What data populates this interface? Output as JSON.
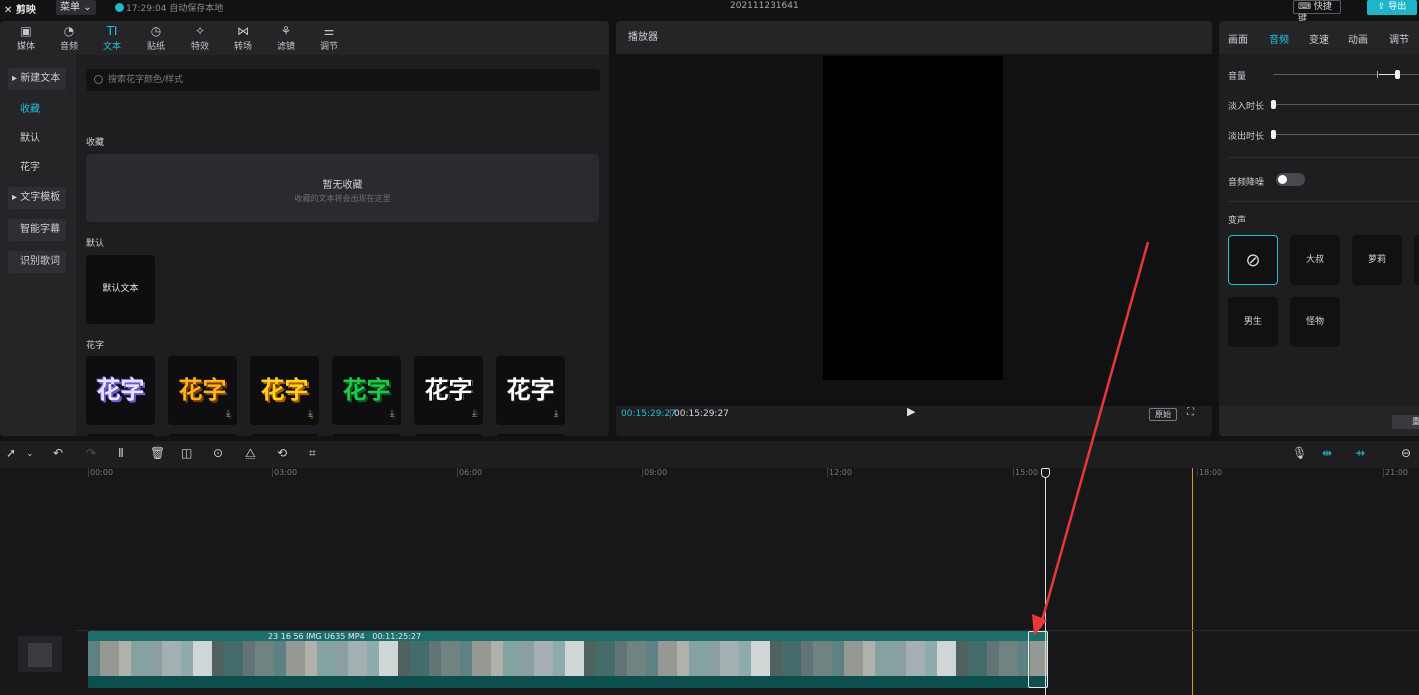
{
  "titlebar": {
    "app_name": "剪映",
    "menu_label": "菜单",
    "save_status": "17:29:04 自动保存本地",
    "project_title": "202111231641",
    "shortcut_label": "快捷键",
    "export_label": "导出"
  },
  "tool_tabs": [
    {
      "label": "媒体",
      "icon": "media-icon"
    },
    {
      "label": "音频",
      "icon": "audio-icon"
    },
    {
      "label": "文本",
      "icon": "text-icon",
      "active": true
    },
    {
      "label": "贴纸",
      "icon": "sticker-icon"
    },
    {
      "label": "特效",
      "icon": "effects-icon"
    },
    {
      "label": "转场",
      "icon": "transition-icon"
    },
    {
      "label": "滤镜",
      "icon": "filter-icon"
    },
    {
      "label": "调节",
      "icon": "adjust-icon"
    }
  ],
  "side_nav": {
    "new_text": "▸ 新建文本",
    "favorites": "收藏",
    "default": "默认",
    "fancy": "花字",
    "templates": "▸ 文字模板",
    "smart_subtitle": "智能字幕",
    "lyrics": "识别歌词"
  },
  "text_panel": {
    "search_placeholder": "搜索花字颜色/样式",
    "favorites_label": "收藏",
    "empty_title": "暂无收藏",
    "empty_sub": "收藏的文本将会出现在这里",
    "default_label": "默认",
    "default_tile": "默认文本",
    "fancy_label": "花字",
    "fancy_tile_text": "花字",
    "download_icon": "⤓"
  },
  "player": {
    "title": "播放器",
    "current_time": "00:15:29:27",
    "total_time": "00:15:29:27",
    "original_label": "原始"
  },
  "inspector": {
    "tabs": [
      "画面",
      "音频",
      "变速",
      "动画",
      "调节"
    ],
    "volume_label": "音量",
    "fade_in_label": "淡入时长",
    "fade_out_label": "淡出时长",
    "denoise_label": "音频降噪",
    "voice_change_label": "变声",
    "voices": [
      "大叔",
      "萝莉",
      "男生",
      "怪物"
    ],
    "footer_btn": "重"
  },
  "timeline": {
    "ruler": [
      "00:00",
      "03:00",
      "06:00",
      "09:00",
      "12:00",
      "15:00",
      "18:00",
      "21:00"
    ],
    "clip_name": "23 16 56 IMG U635 MP4",
    "clip_duration": "00:11:25:27"
  },
  "colors": {
    "accent": "#23c1d4",
    "annotation_arrow": "#e8363a",
    "marker": "#c9a22a"
  }
}
